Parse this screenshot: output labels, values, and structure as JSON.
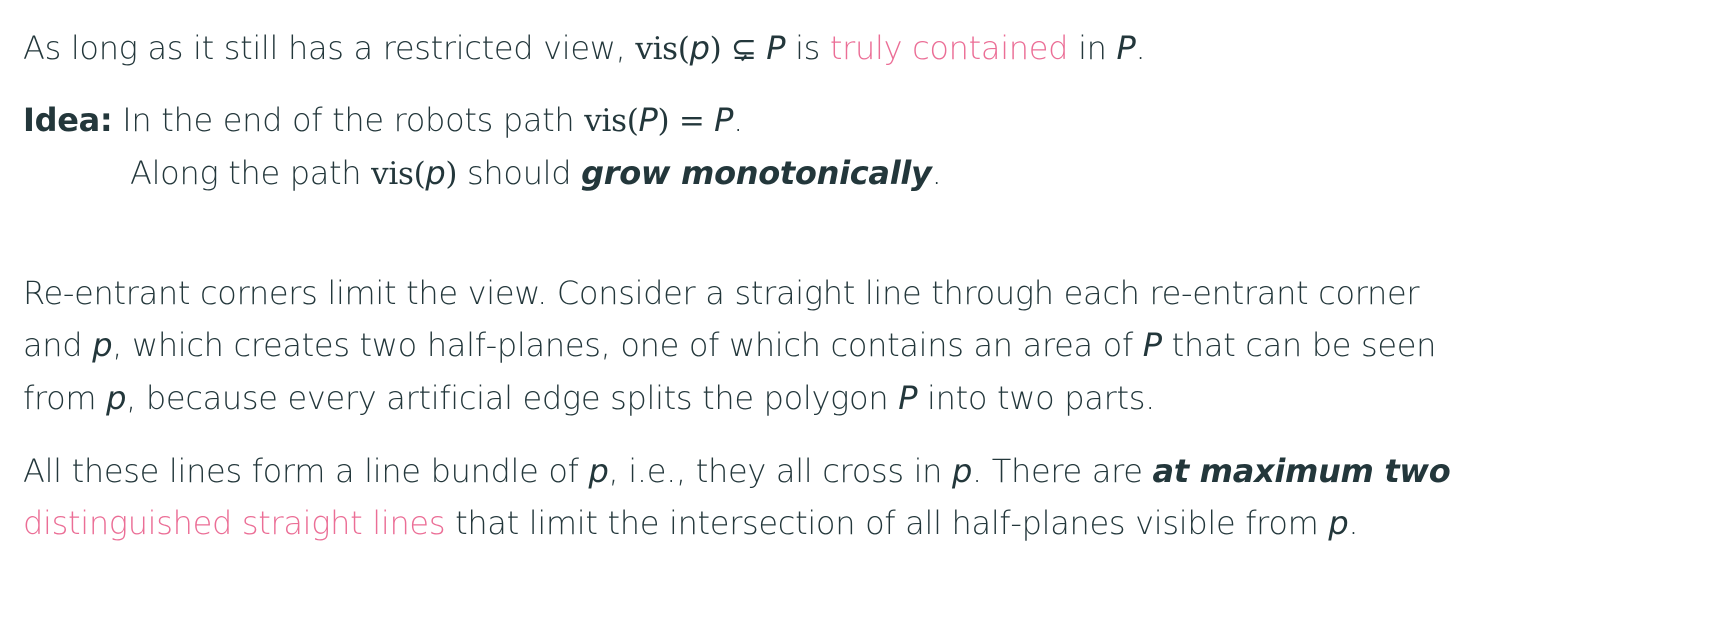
{
  "line1": {
    "a": "As long as it still has a restricted view, ",
    "vis": "vis",
    "p_open": "(",
    "p": "p",
    "p_close": ")",
    "rel": " ⊊ ",
    "P": "P",
    "b": " is ",
    "alert": "truly contained",
    "c": " in ",
    "P2": "P",
    "d": "."
  },
  "idea": {
    "label": "Idea:",
    "a": " In the end of the robots path ",
    "vis": "vis",
    "open": "(",
    "P": "P",
    "close": ")",
    "eq": " = ",
    "P2": "P",
    "end": "."
  },
  "idea2": {
    "a": "Along the path ",
    "vis": "vis",
    "open": "(",
    "p": "p",
    "close": ")",
    "b": " should ",
    "em": "grow monotonically",
    "end": "."
  },
  "para1": {
    "l1": "Re-entrant corners limit the view. Consider a straight line through each re-entrant corner",
    "l2a": "and ",
    "l2p": "p",
    "l2b": ", which creates two half-planes, one of which contains an area of ",
    "l2P": "P",
    "l2c": " that can be seen",
    "l3a": "from ",
    "l3p": "p",
    "l3b": ", because every artificial edge splits the polygon ",
    "l3P": "P",
    "l3c": " into two parts."
  },
  "para2": {
    "l1a": "All these lines form a line bundle of ",
    "l1p": "p",
    "l1b": ", i.e., they all cross in ",
    "l1p2": "p",
    "l1c": ". There are ",
    "l1em": "at maximum two",
    "l2alert": "distinguished straight lines",
    "l2a": " that limit the intersection of all half-planes visible from ",
    "l2p": "p",
    "l2end": "."
  },
  "colors": {
    "text": "#23373b",
    "alert": "#eb6e96"
  }
}
